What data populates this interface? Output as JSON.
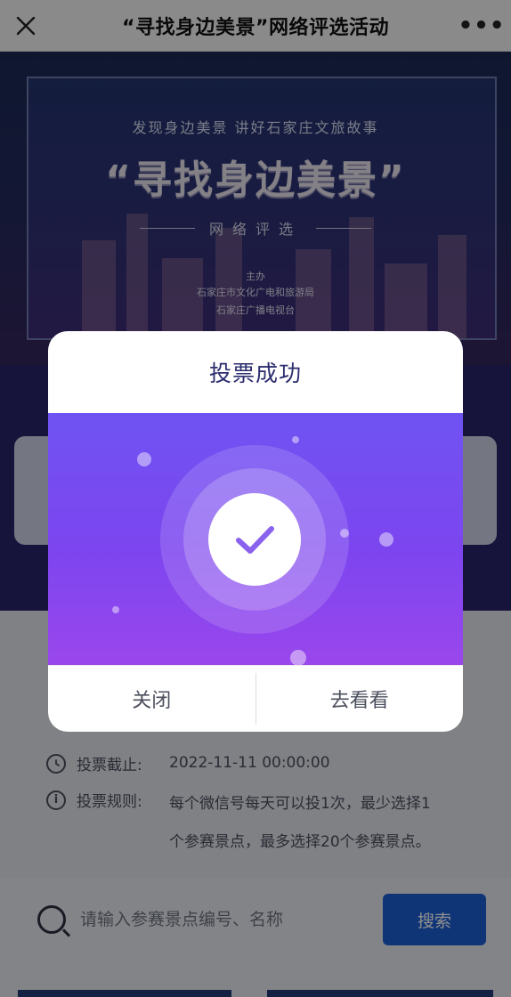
{
  "navbar": {
    "title": "“寻找身边美景”网络评选活动",
    "close_icon": "close-icon",
    "more_icon": "more-icon",
    "more_label": "•••"
  },
  "banner": {
    "slogan": "发现身边美景 讲好石家庄文旅故事",
    "title": "“寻找身边美景”",
    "subtitle": "网络评选",
    "host_label": "主办",
    "host_1": "石家庄市文化广电和旅游局",
    "host_2": "石家庄广播电视台"
  },
  "info": {
    "deadline_label": "投票截止:",
    "deadline_value": "2022-11-11 00:00:00",
    "rules_label": "投票规则:",
    "rules_line1": "每个微信号每天可以投1次，最少选择1",
    "rules_line2": "个参赛景点，最多选择20个参赛景点。",
    "clock_icon": "clock-icon",
    "info_icon": "info-icon",
    "info_glyph": "i"
  },
  "search": {
    "placeholder": "请输入参赛景点编号、名称",
    "button_label": "搜索",
    "search_icon": "search-icon"
  },
  "modal": {
    "title": "投票成功",
    "close_label": "关闭",
    "view_label": "去看看",
    "check_icon": "check-icon"
  },
  "colors": {
    "accent": "#7b4cf0",
    "title_text": "#2b2d6e",
    "search_button": "#1e5fd4"
  }
}
